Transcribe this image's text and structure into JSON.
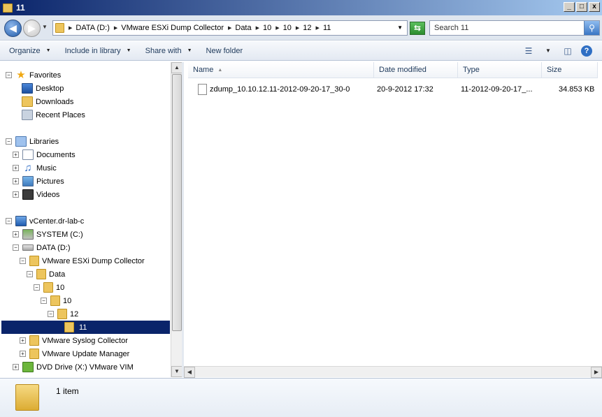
{
  "window": {
    "title": "11",
    "controls": [
      "_",
      "□",
      "x"
    ]
  },
  "address": {
    "crumbs": [
      "DATA (D:)",
      "VMware ESXi Dump Collector",
      "Data",
      "10",
      "10",
      "12",
      "11"
    ]
  },
  "search": {
    "placeholder": "Search 11"
  },
  "toolbar": {
    "organize": "Organize",
    "include_in_library": "Include in library",
    "share_with": "Share with",
    "new_folder": "New folder"
  },
  "nav": {
    "favorites": "Favorites",
    "desktop": "Desktop",
    "downloads": "Downloads",
    "recent_places": "Recent Places",
    "libraries": "Libraries",
    "documents": "Documents",
    "music": "Music",
    "pictures": "Pictures",
    "videos": "Videos",
    "computer": "vCenter.dr-lab-c",
    "system_c": "SYSTEM (C:)",
    "data_d": "DATA (D:)",
    "dump_collector": "VMware ESXi Dump Collector",
    "data_folder": "Data",
    "f10a": "10",
    "f10b": "10",
    "f12": "12",
    "f11": "11",
    "syslog": "VMware Syslog Collector",
    "update_manager": "VMware Update Manager",
    "dvd": "DVD Drive (X:) VMware VIM"
  },
  "columns": {
    "name": "Name",
    "date_modified": "Date modified",
    "type": "Type",
    "size": "Size"
  },
  "files": [
    {
      "name": "zdump_10.10.12.11-2012-09-20-17_30-0",
      "date_modified": "20-9-2012 17:32",
      "type": "11-2012-09-20-17_...",
      "size": "34.853 KB"
    }
  ],
  "status": {
    "item_count": "1 item"
  }
}
